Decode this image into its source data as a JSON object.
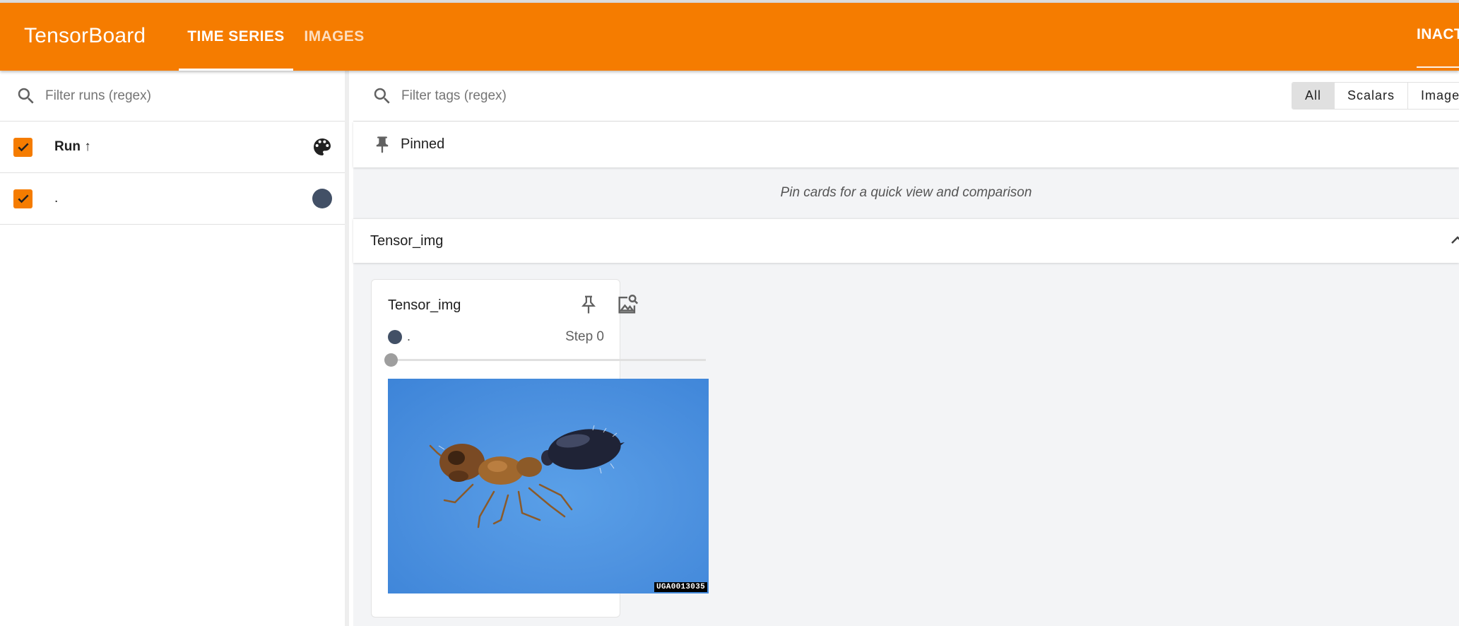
{
  "app": {
    "brand": "TensorBoard",
    "tabs": [
      {
        "label": "TIME SERIES",
        "active": true
      },
      {
        "label": "IMAGES",
        "active": false
      }
    ],
    "status": "INACTIVE",
    "accent_color": "#f57c00"
  },
  "sidebar": {
    "search_placeholder": "Filter runs (regex)",
    "header_label": "Run ↑",
    "runs": [
      {
        "label": ".",
        "checked": true,
        "color": "#425066"
      }
    ]
  },
  "main": {
    "search_placeholder": "Filter tags (regex)",
    "type_filters": [
      "All",
      "Scalars",
      "Image"
    ],
    "selected_filter": "All",
    "pinned_title": "Pinned",
    "pinned_empty": "Pin cards for a quick view and comparison",
    "group_title": "Tensor_img",
    "card": {
      "title": "Tensor_img",
      "run": ".",
      "step": "Step 0",
      "step_fraction": 0,
      "image_watermark": "UGA0013035"
    }
  }
}
